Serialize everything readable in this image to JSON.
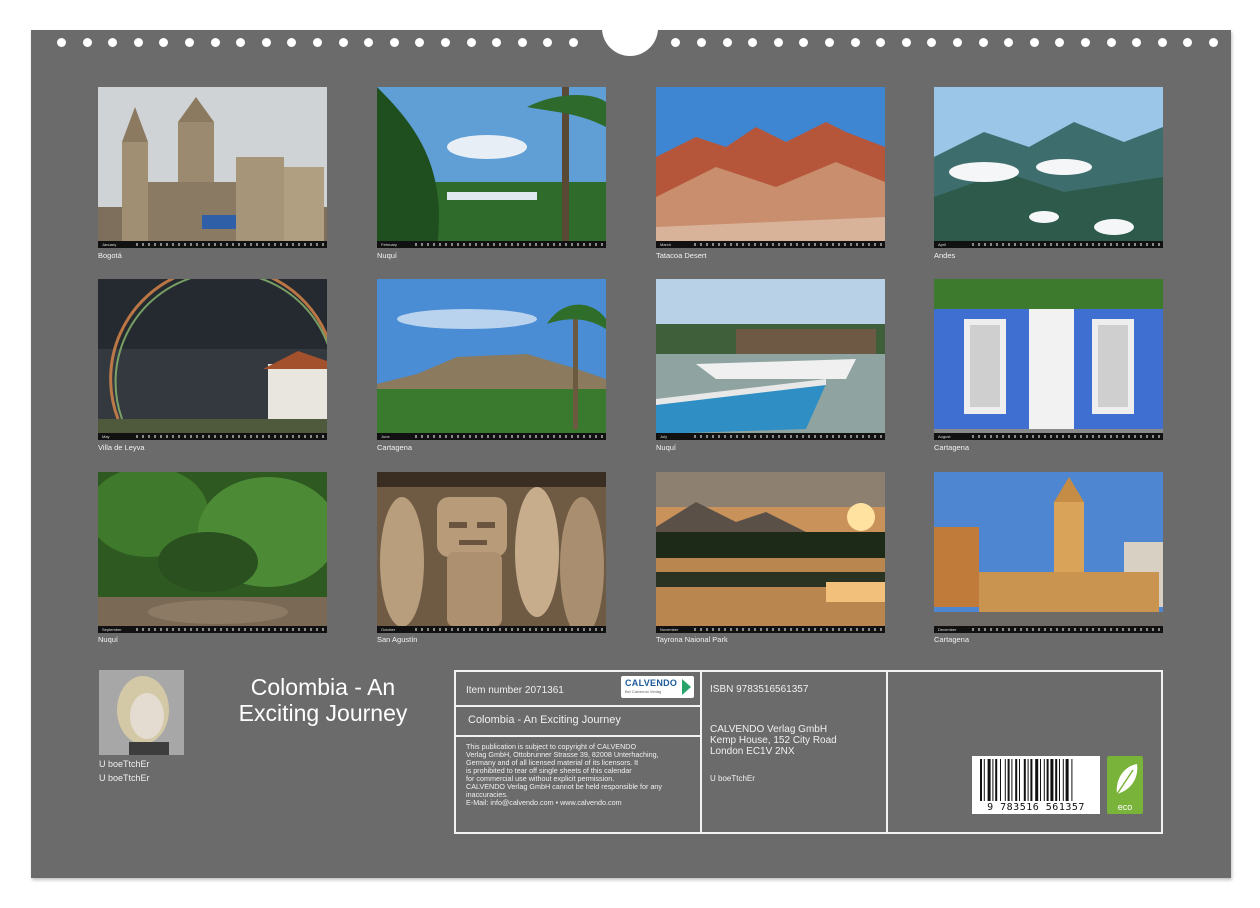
{
  "photos": [
    {
      "caption": "Bogotá",
      "month": "January",
      "theme": "cathedral"
    },
    {
      "caption": "Nuquí",
      "month": "February",
      "theme": "palms"
    },
    {
      "caption": "Tatacoa Desert",
      "month": "March",
      "theme": "desert"
    },
    {
      "caption": "Andes",
      "month": "April",
      "theme": "mountains"
    },
    {
      "caption": "Villa de Leyva",
      "month": "May",
      "theme": "rainbow"
    },
    {
      "caption": "Cartagena",
      "month": "June",
      "theme": "fortress"
    },
    {
      "caption": "Nuquí",
      "month": "July",
      "theme": "boats"
    },
    {
      "caption": "Cartagena",
      "month": "August",
      "theme": "bluehouse"
    },
    {
      "caption": "Nuquí",
      "month": "September",
      "theme": "jungle"
    },
    {
      "caption": "San Agustín",
      "month": "October",
      "theme": "statue"
    },
    {
      "caption": "Tayrona Naional Park",
      "month": "November",
      "theme": "sunset"
    },
    {
      "caption": "Cartagena",
      "month": "December",
      "theme": "clocktower"
    }
  ],
  "author": {
    "line1": "U boeTtchEr",
    "line2": "U boeTtchEr"
  },
  "title": "Colombia  - An Exciting Journey",
  "info": {
    "item_number": "Item number 2071361",
    "logo_text": "CALVENDO",
    "logo_sub": "Bei Calvendo Verlag",
    "subtitle": "Colombia  - An Exciting Journey",
    "copyright": [
      "This publication is subject to copyright of CALVENDO",
      "Verlag GmbH, Ottobrunner Strasse 39, 82008 Unterhaching,",
      "Germany and of all licensed material of its licensors. It",
      "is prohibited to tear off single sheets of this calendar",
      "for commercial use without explicit permission.",
      "CALVENDO Verlag GmbH cannot be held responsible for any",
      "inaccuracies.",
      "E-Mail: info@calvendo.com • www.calvendo.com"
    ],
    "isbn": "ISBN 9783516561357",
    "publisher": [
      "CALVENDO Verlag GmbH",
      "Kemp House, 152 City Road",
      "London EC1V 2NX"
    ],
    "author_small": "U boeTtchEr",
    "barcode_digits": "9 783516 561357",
    "eco_label": "eco"
  },
  "colors": {
    "sheet": "#6b6b6b",
    "eco": "#7ab33a",
    "logo_blue": "#1d5a9a"
  }
}
